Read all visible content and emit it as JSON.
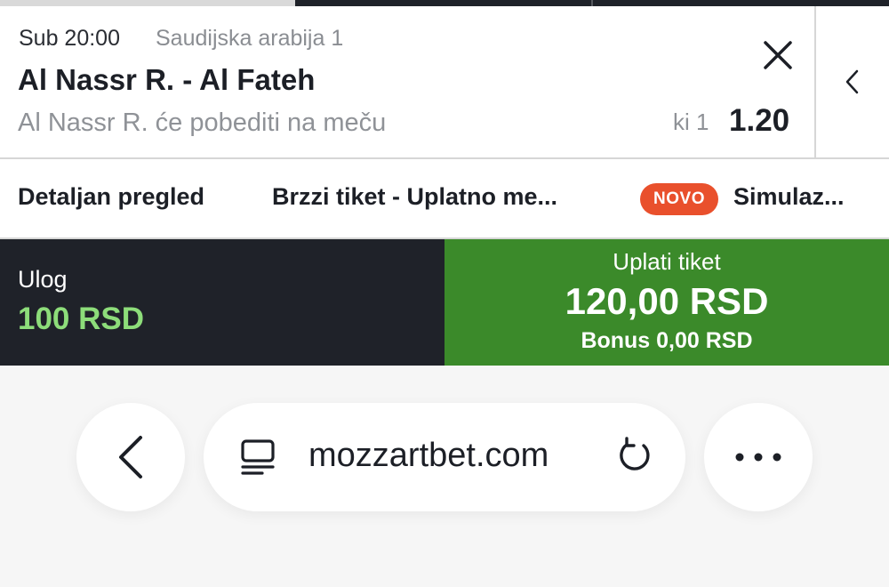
{
  "selection": {
    "time": "Sub 20:00",
    "league": "Saudijska arabija 1",
    "match": "Al Nassr R. - Al Fateh",
    "prediction": "Al Nassr R. će pobediti na meču",
    "bet_type": "ki 1",
    "odds": "1.20"
  },
  "tabs": [
    {
      "label": "Detaljan pregled"
    },
    {
      "label": "Brzzi tiket - Uplatno me..."
    },
    {
      "label": "Simulaz..."
    }
  ],
  "badge": {
    "label": "NOVO"
  },
  "stake": {
    "label": "Ulog",
    "value": "100 RSD"
  },
  "pay": {
    "label": "Uplati tiket",
    "amount": "120,00 RSD",
    "bonus": "Bonus 0,00 RSD"
  },
  "browser": {
    "url": "mozzartbet.com"
  },
  "icons": [
    "close-icon",
    "chevron-left-icon",
    "back-arrow-icon",
    "reader-icon",
    "reload-icon",
    "more-icon"
  ],
  "colors": {
    "dark": "#1f2229",
    "pay_green": "#3b8a2a",
    "stake_green": "#8ddd7a",
    "badge_orange": "#e9502c"
  }
}
